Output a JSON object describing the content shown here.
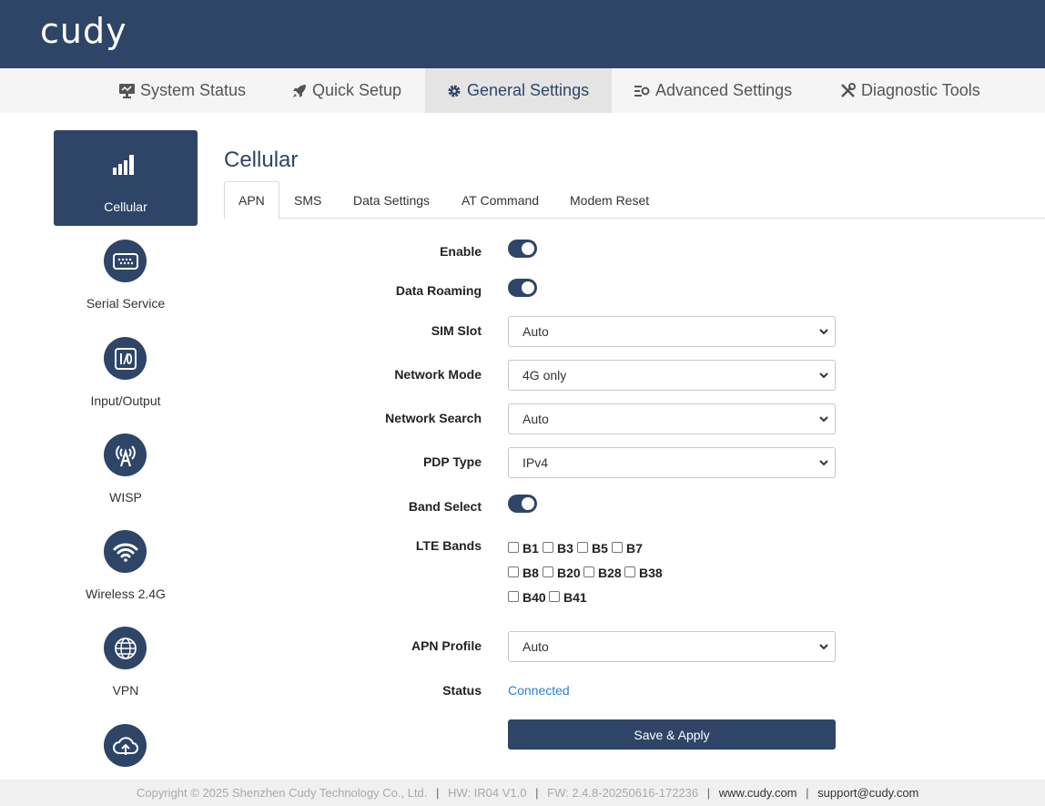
{
  "brand": {
    "logo_text": "cudy",
    "primary_color": "#2e4567",
    "link_color": "#2b7fd4"
  },
  "nav": {
    "items": [
      {
        "label": "System Status",
        "icon": "monitor-icon"
      },
      {
        "label": "Quick Setup",
        "icon": "rocket-icon"
      },
      {
        "label": "General Settings",
        "icon": "gear-icon",
        "active": true
      },
      {
        "label": "Advanced Settings",
        "icon": "sliders-gear-icon"
      },
      {
        "label": "Diagnostic Tools",
        "icon": "tools-icon"
      }
    ]
  },
  "sidebar": {
    "items": [
      {
        "label": "Cellular",
        "icon": "signal-bars-icon",
        "active": true
      },
      {
        "label": "Serial Service",
        "icon": "serial-port-icon"
      },
      {
        "label": "Input/Output",
        "icon": "io-icon"
      },
      {
        "label": "WISP",
        "icon": "antenna-icon"
      },
      {
        "label": "Wireless 2.4G",
        "icon": "wifi-icon"
      },
      {
        "label": "VPN",
        "icon": "globe-icon"
      },
      {
        "label": "",
        "icon": "cloud-upload-icon"
      }
    ]
  },
  "page": {
    "title": "Cellular",
    "tabs": [
      {
        "label": "APN",
        "active": true
      },
      {
        "label": "SMS"
      },
      {
        "label": "Data Settings"
      },
      {
        "label": "AT Command"
      },
      {
        "label": "Modem Reset"
      }
    ]
  },
  "form": {
    "enable": {
      "label": "Enable",
      "on": true
    },
    "data_roaming": {
      "label": "Data Roaming",
      "on": true
    },
    "sim_slot": {
      "label": "SIM Slot",
      "value": "Auto"
    },
    "network_mode": {
      "label": "Network Mode",
      "value": "4G only"
    },
    "network_search": {
      "label": "Network Search",
      "value": "Auto"
    },
    "pdp_type": {
      "label": "PDP Type",
      "value": "IPv4"
    },
    "band_select": {
      "label": "Band Select",
      "on": true
    },
    "lte_bands": {
      "label": "LTE Bands",
      "bands": [
        "B1",
        "B3",
        "B5",
        "B7",
        "B8",
        "B20",
        "B28",
        "B38",
        "B40",
        "B41"
      ]
    },
    "apn_profile": {
      "label": "APN Profile",
      "value": "Auto"
    },
    "status": {
      "label": "Status",
      "value": "Connected"
    },
    "save_label": "Save & Apply"
  },
  "footer": {
    "copyright": "Copyright © 2025 Shenzhen Cudy Technology Co., Ltd.",
    "hw": "HW: IR04 V1.0",
    "fw": "FW: 2.4.8-20250616-172236",
    "website": "www.cudy.com",
    "email": "support@cudy.com",
    "separator": "|"
  }
}
